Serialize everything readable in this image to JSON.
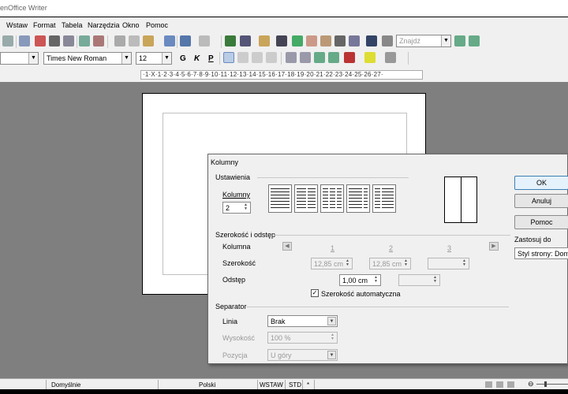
{
  "window": {
    "title": "enOffice Writer"
  },
  "menu": [
    "Wstaw",
    "Format",
    "Tabela",
    "Narzędzia",
    "Okno",
    "Pomoc"
  ],
  "toolbar1": {
    "find_placeholder": "Znajdź"
  },
  "toolbar2": {
    "font_name": "Times New Roman",
    "font_size": "12",
    "bold": "G",
    "italic": "K",
    "underline": "P"
  },
  "ruler": {
    "text": "·1·X·1·2·3·4·5·6·7·8·9·10·11·12·13·14·15·16·17·18·19·20·21·22·23·24·25·26·27·"
  },
  "status": {
    "page_style": "Domyślnie",
    "language": "Polski",
    "insert_mode": "WSTAW",
    "selection_mode": "STD",
    "star": "*"
  },
  "dialog": {
    "title": "Kolumny",
    "settings_group": "Ustawienia",
    "columns_label": "Kolumny",
    "columns_value": "2",
    "width_spacing_group": "Szerokość i odstęp",
    "column_label": "Kolumna",
    "col_numbers": [
      "1",
      "2",
      "3"
    ],
    "width_label": "Szerokość",
    "width_values": [
      "12,85 cm",
      "12,85 cm",
      ""
    ],
    "spacing_label": "Odstęp",
    "spacing_values": [
      "1,00 cm",
      ""
    ],
    "auto_width_label": "Szerokość automatyczna",
    "auto_width_checked": true,
    "separator_group": "Separator",
    "line_label": "Linia",
    "line_value": "Brak",
    "height_label": "Wysokość",
    "height_value": "100 %",
    "position_label": "Pozycja",
    "position_value": "U góry",
    "ok": "OK",
    "cancel": "Anuluj",
    "help": "Pomoc",
    "apply_to_label": "Zastosuj do",
    "apply_to_value": "Styl strony: Domy"
  }
}
